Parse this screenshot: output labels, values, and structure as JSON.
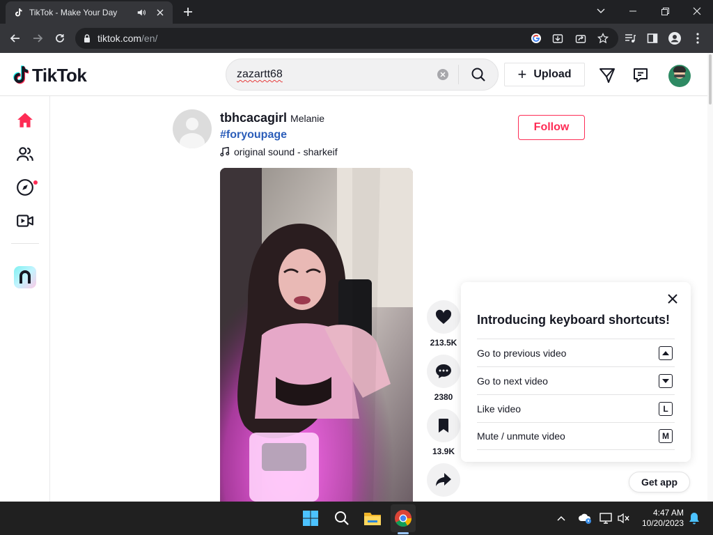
{
  "browser": {
    "tab_title": "TikTok - Make Your Day",
    "url_host": "tiktok.com",
    "url_path": "/en/"
  },
  "header": {
    "logo_text": "TikTok",
    "search_value": "zazartt68",
    "upload_label": "Upload"
  },
  "post": {
    "handle": "tbhcacagirl",
    "nickname": "Melanie",
    "hashtag": "#foryoupage",
    "sound": "original sound - sharkeif",
    "follow_label": "Follow",
    "likes": "213.5K",
    "comments": "2380",
    "saves": "13.9K"
  },
  "shortcuts": {
    "title": "Introducing keyboard shortcuts!",
    "items": [
      {
        "label": "Go to previous video",
        "key_icon": "arrow-up-key-icon"
      },
      {
        "label": "Go to next video",
        "key_icon": "arrow-down-key-icon"
      },
      {
        "label": "Like video",
        "key": "L"
      },
      {
        "label": "Mute / unmute video",
        "key": "M"
      }
    ]
  },
  "get_app_label": "Get app",
  "taskbar": {
    "time": "4:47 AM",
    "date": "10/20/2023"
  },
  "colors": {
    "brand_red": "#fe2c55",
    "hashtag_blue": "#2b5db9",
    "chrome_dark": "#202124",
    "chrome_toolbar": "#35363a"
  }
}
